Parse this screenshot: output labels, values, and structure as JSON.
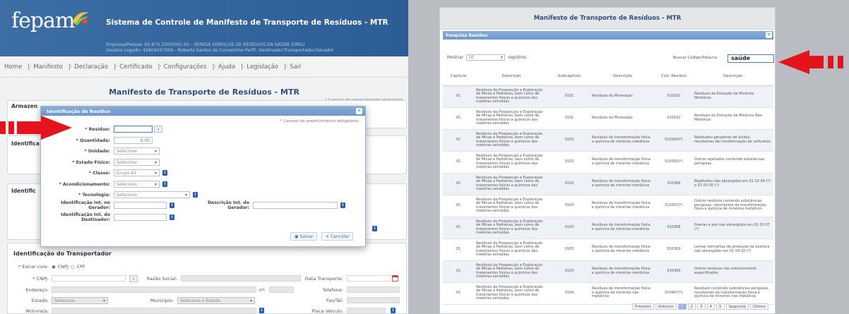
{
  "left": {
    "logo_text": "fepam",
    "system_title": "Sistema de Controle de Manifesto de Transporte de Resíduos - MTR",
    "session_line1": "Empresa/Pessoa: 02.870.330/0001-93 - SERESA SERVIÇOS DE RESÍDUOS DA SAÚDE EIRELI",
    "session_line2": "Usuário Logado: 42804257000 - Roberta Santos do Conselinho  Perfil: Destinador/Transportador/Gerador",
    "nav": [
      "Home",
      "Manifesto",
      "Declaração",
      "Certificado",
      "Configurações",
      "Ajuda",
      "Legislação",
      "Sair"
    ],
    "page_title": "Manifesto de Transporte de Resíduos - MTR",
    "required_note": "* Campos de preenchimento obrigatório",
    "bg_labels": [
      "Armazen",
      "Identifica",
      "Identific"
    ],
    "transportador": {
      "title": "Identificação do Transportador",
      "estrangeiro_label": "* Estrar core:",
      "opt_cnpj": "CNPJ",
      "opt_cpf": "CPF",
      "cnpj_label": "* CNPJ:",
      "razao_label": "Razão Social:",
      "data_label": "Data Transporte:",
      "endereco_label": "Endereço:",
      "n_label": "nº:",
      "telefone_label": "Telefone:",
      "estado_label": "Estado:",
      "estado_value": "Selecione",
      "municipio_label": "Município:",
      "municipio_value": "Selecione o Estado",
      "fax_label": "Fax/Tel:",
      "motorista_label": "Motorista:",
      "placa_label": "Placa Veículo:"
    }
  },
  "modal": {
    "title": "Identificação de Resíduo",
    "required_note": "* Campos de preenchimento obrigatório",
    "residuo_label": "* Resíduo:",
    "quantidade_label": "* Quantidade:",
    "quantidade_value": "0,00",
    "unidade_label": "* Unidade:",
    "unidade_value": "Selecione",
    "estado_label": "* Estado Físico:",
    "estado_value": "Selecione",
    "classe_label": "* Classe:",
    "classe_value": "Grupo A1",
    "acond_label": "* Acondicionamento:",
    "acond_value": "Selecione",
    "tecnologia_label": "* Tecnologia:",
    "tecnologia_value": "Selecione",
    "id_gerador_label": "Identificação Int. no Gerador:",
    "id_destinador_label": "Identificação Int. do Destinador:",
    "desc_gerador_label": "Descrição Int. do Gerador:",
    "save_label": "Salvar",
    "cancel_label": "Cancelar"
  },
  "right": {
    "header_title": "Manifesto de Transporte de Resíduos - MTR",
    "bar_title": "Pesquisa Resíduo",
    "show_label": "Mostrar",
    "show_value": "10",
    "records_label": "registros",
    "search_label": "Buscar Código/Palavra:",
    "search_value": "saúde",
    "columns": [
      "Capítulo",
      "Descrição",
      "Subcapítulo",
      "Descrição",
      "Cód. Resíduo",
      "Descrição"
    ],
    "rows": [
      [
        "01",
        "Resíduos da Prospecção e Exploração de Minas e Pedreiras, bem como de tratamentos físicos e químicos das matérias extraídas",
        "0101",
        "Resíduos da Mineração",
        "010101",
        "Resíduos da Extração de Minérios Metálicos"
      ],
      [
        "01",
        "Resíduos da Prospecção e Exploração de Minas e Pedreiras, bem como de tratamentos físicos e químicos das matérias extraídas",
        "0101",
        "Resíduos da Mineração",
        "010102",
        "Resíduos da Extração de Minérios Não Metálicos"
      ],
      [
        "01",
        "Resíduos da Prospecção e Exploração de Minas e Pedreiras, bem como de tratamentos físicos e químicos das matérias extraídas",
        "0103",
        "Resíduos de transformação física e química de minérios metálicos",
        "010304(*)",
        "Rejeitados geradores de ácidos, resultantes da transformação de sulfuretos"
      ],
      [
        "01",
        "Resíduos da Prospecção e Exploração de Minas e Pedreiras, bem como de tratamentos físicos e químicos das matérias extraídas",
        "0103",
        "Resíduos de transformação física e química de minérios metálicos",
        "010305(*)",
        "Outros rejeitados contendo substâncias perigosas"
      ],
      [
        "01",
        "Resíduos da Prospecção e Exploração de Minas e Pedreiras, bem como de tratamentos físicos e químicos das matérias extraídas",
        "0103",
        "Resíduos de transformação física e química de minérios metálicos",
        "010306",
        "Rejeitados não abrangidos em 01 03 04 (*) e 01 03 05 (*)"
      ],
      [
        "01",
        "Resíduos da Prospecção e Exploração de Minas e Pedreiras, bem como de tratamentos físicos e químicos das matérias extraídas",
        "0103",
        "Resíduos de transformação física e química de minérios metálicos",
        "010307(*)",
        "Outros resíduos contendo substâncias perigosas, resultantes da transformação física e química de minérios metálicos"
      ],
      [
        "01",
        "Resíduos da Prospecção e Exploração de Minas e Pedreiras, bem como de tratamentos físicos e químicos das matérias extraídas",
        "0103",
        "Resíduos de transformação física e química de minérios metálicos",
        "010308",
        "Poeiras e pós não abrangidos em 01 03 07 (*)"
      ],
      [
        "01",
        "Resíduos da Prospecção e Exploração de Minas e Pedreiras, bem como de tratamentos físicos e químicos das matérias extraídas",
        "0103",
        "Resíduos de transformação física e química de minérios metálicos",
        "010309",
        "Lamas vermelhas da produção de alumina não abrangidas em 01 03 10 (*)"
      ],
      [
        "01",
        "Resíduos da Prospecção e Exploração de Minas e Pedreiras, bem como de tratamentos físicos e químicos das matérias extraídas",
        "0103",
        "Resíduos de transformação física e química de minérios metálicos",
        "010399",
        "Outros resíduos não anteriormente especificados"
      ],
      [
        "01",
        "Resíduos da Prospecção e Exploração de Minas e Pedreiras, bem como de tratamentos físicos e químicos das matérias extraídas",
        "0104",
        "Resíduos de transformação física e química de minérios não metálicos",
        "010407(*)",
        "Resíduos contendo substâncias perigosas, resultantes da transformação física e química de minérios não metálicos"
      ]
    ],
    "pager": [
      "Primeiro",
      "Anterior",
      "1",
      "2",
      "3",
      "4",
      "5",
      "Seguinte",
      "Último"
    ],
    "active_page": "1"
  },
  "colors": {
    "accent": "#2f4f80",
    "arrow": "#e3141e",
    "title_bar": "#7aa2d1"
  }
}
